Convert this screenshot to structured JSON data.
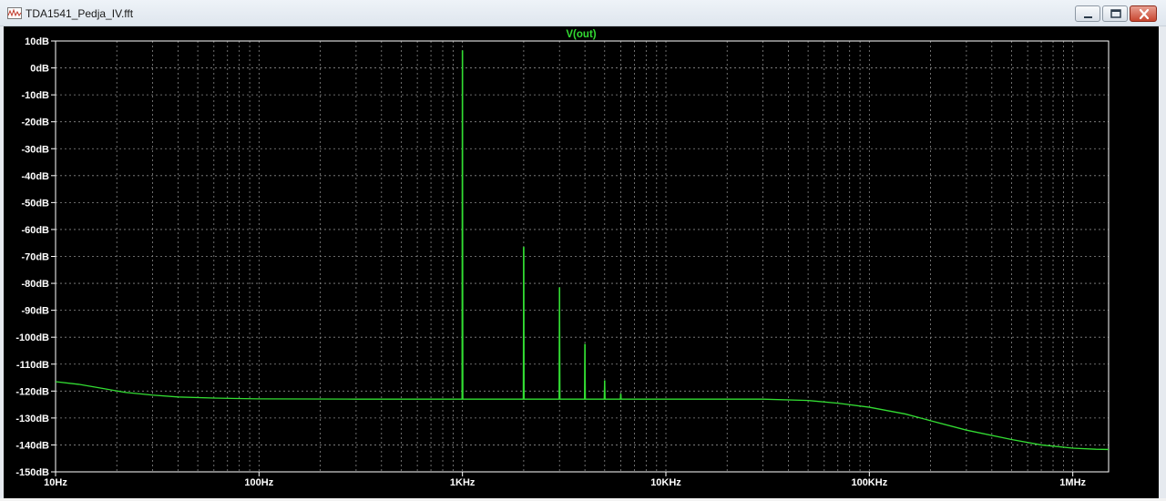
{
  "window": {
    "title": "TDA1541_Pedja_IV.fft",
    "icon": "waveform-icon",
    "buttons": [
      "minimize-icon",
      "maximize-icon",
      "close-icon"
    ]
  },
  "colors": {
    "background": "#000000",
    "trace": "#33dd33",
    "grid": "#8a8a8a",
    "text": "#ffffff",
    "title": "#33dd33"
  },
  "chart_data": {
    "type": "line",
    "title": "V(out)",
    "xscale": "log",
    "xlim": [
      10,
      1500000
    ],
    "ylim": [
      -150,
      10
    ],
    "grid": true,
    "x_tick_labels": [
      {
        "value": 10,
        "label": "10Hz"
      },
      {
        "value": 100,
        "label": "100Hz"
      },
      {
        "value": 1000,
        "label": "1KHz"
      },
      {
        "value": 10000,
        "label": "10KHz"
      },
      {
        "value": 100000,
        "label": "100KHz"
      },
      {
        "value": 1000000,
        "label": "1MHz"
      }
    ],
    "y_ticks": [
      10,
      0,
      -10,
      -20,
      -30,
      -40,
      -50,
      -60,
      -70,
      -80,
      -90,
      -100,
      -110,
      -120,
      -130,
      -140,
      -150
    ],
    "y_tick_labels": [
      "10dB",
      "0dB",
      "-10dB",
      "-20dB",
      "-30dB",
      "-40dB",
      "-50dB",
      "-60dB",
      "-70dB",
      "-80dB",
      "-90dB",
      "-100dB",
      "-110dB",
      "-120dB",
      "-130dB",
      "-140dB",
      "-150dB"
    ],
    "series": [
      {
        "name": "V(out)",
        "noise_floor": [
          [
            10,
            -116.5
          ],
          [
            13,
            -117.5
          ],
          [
            17,
            -119
          ],
          [
            22,
            -120.5
          ],
          [
            30,
            -121.5
          ],
          [
            40,
            -122.2
          ],
          [
            60,
            -122.6
          ],
          [
            100,
            -122.9
          ],
          [
            300,
            -123
          ],
          [
            1000,
            -123
          ],
          [
            10000,
            -123
          ],
          [
            30000,
            -123
          ],
          [
            50000,
            -123.5
          ],
          [
            70000,
            -124.5
          ],
          [
            100000,
            -126
          ],
          [
            150000,
            -128.5
          ],
          [
            200000,
            -131
          ],
          [
            300000,
            -134.5
          ],
          [
            500000,
            -138
          ],
          [
            700000,
            -140
          ],
          [
            1000000,
            -141.2
          ],
          [
            1300000,
            -141.6
          ],
          [
            1500000,
            -141.7
          ]
        ],
        "peaks": [
          {
            "x": 1000,
            "y": 6.5
          },
          {
            "x": 2000,
            "y": -66.5
          },
          {
            "x": 3000,
            "y": -81.5
          },
          {
            "x": 4000,
            "y": -102.5
          },
          {
            "x": 5000,
            "y": -116
          },
          {
            "x": 6000,
            "y": -121
          }
        ]
      }
    ]
  }
}
